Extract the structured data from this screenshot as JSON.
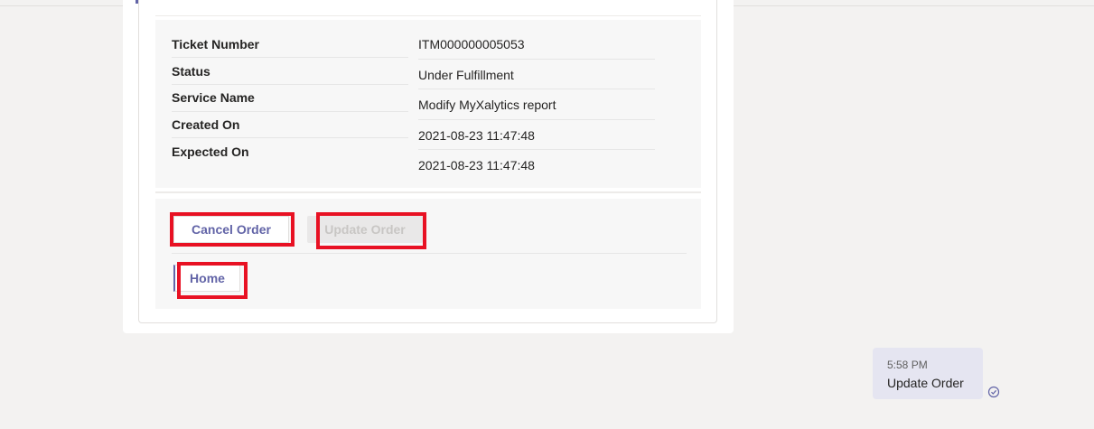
{
  "ticket": {
    "fields": [
      {
        "label": "Ticket Number",
        "value": "ITM000000005053"
      },
      {
        "label": "Status",
        "value": "Under Fulfillment"
      },
      {
        "label": "Service Name",
        "value": "Modify MyXalytics report"
      },
      {
        "label": "Created On",
        "value": "2021-08-23 11:47:48"
      },
      {
        "label": "Expected On",
        "value": "2021-08-23 11:47:48"
      }
    ]
  },
  "actions": {
    "cancel_label": "Cancel Order",
    "update_label": "Update Order",
    "home_label": "Home"
  },
  "message": {
    "time": "5:58 PM",
    "text": "Update Order",
    "status_icon": "read-receipt-icon"
  },
  "colors": {
    "accent": "#6264a7",
    "highlight": "#e81123",
    "bubble": "#e5e5f1"
  }
}
